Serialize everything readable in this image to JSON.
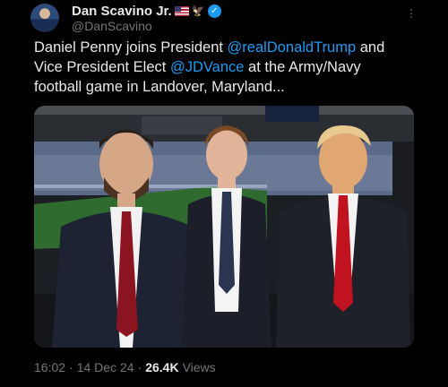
{
  "author": {
    "display_name": "Dan Scavino Jr.",
    "handle": "@DanScavino",
    "icons": [
      "us-flag-icon",
      "eagle-icon",
      "verified-badge-icon"
    ],
    "verified_color": "#1d9bf0"
  },
  "tweet": {
    "text_part1": "Daniel Penny joins President ",
    "mention1": "@realDonaldTrump",
    "text_part2": " and Vice President Elect ",
    "mention2": "@JDVance",
    "text_part3": " at the Army/Navy football game in Landover, Maryland..."
  },
  "footer": {
    "time": "16:02",
    "separator": "·",
    "date": "14 Dec 24",
    "views_count": "26.4K",
    "views_label": "Views"
  },
  "colors": {
    "background": "#000000",
    "text": "#e7e9ea",
    "secondary": "#71767b",
    "link": "#1d9bf0"
  }
}
